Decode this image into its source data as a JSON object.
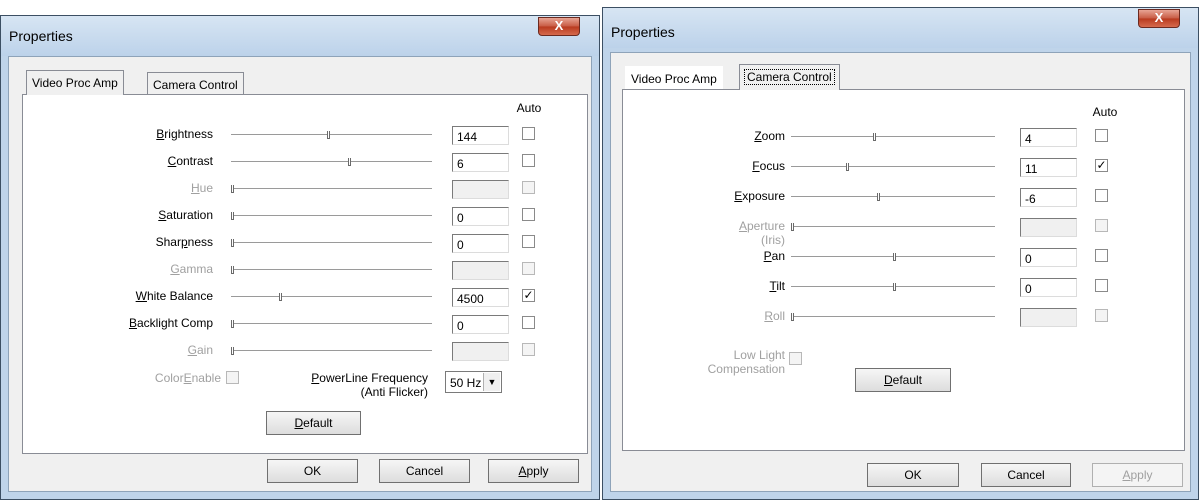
{
  "left": {
    "title": "Properties",
    "close_label": "X",
    "tabs": [
      {
        "label": "Video Proc Amp",
        "active": true
      },
      {
        "label": "Camera Control",
        "active": false
      }
    ],
    "auto_header": "Auto",
    "rows": [
      {
        "label": "Brightness",
        "value": "144",
        "slider": 0.48,
        "enabled": true,
        "auto": false
      },
      {
        "label": "Contrast",
        "value": "6",
        "slider": 0.58,
        "enabled": true,
        "auto": false
      },
      {
        "label": "Hue",
        "value": "",
        "slider": 0.0,
        "enabled": false,
        "auto": false
      },
      {
        "label": "Saturation",
        "value": "0",
        "slider": 0.0,
        "enabled": true,
        "auto": false
      },
      {
        "label": "Sharpness",
        "value": "0",
        "slider": 0.0,
        "enabled": true,
        "auto": false
      },
      {
        "label": "Gamma",
        "value": "",
        "slider": 0.0,
        "enabled": false,
        "auto": false
      },
      {
        "label": "White Balance",
        "value": "4500",
        "slider": 0.24,
        "enabled": true,
        "auto": true
      },
      {
        "label": "Backlight Comp",
        "value": "0",
        "slider": 0.0,
        "enabled": true,
        "auto": false
      },
      {
        "label": "Gain",
        "value": "",
        "slider": 0.0,
        "enabled": false,
        "auto": false
      }
    ],
    "color_enable_label": "ColorEnable",
    "powerline_label": "PowerLine Frequency",
    "powerline_sub": "(Anti Flicker)",
    "powerline_value": "50 Hz",
    "default_label": "Default",
    "ok_label": "OK",
    "cancel_label": "Cancel",
    "apply_label": "Apply"
  },
  "right": {
    "title": "Properties",
    "close_label": "X",
    "tabs": [
      {
        "label": "Video Proc Amp",
        "active": false
      },
      {
        "label": "Camera Control",
        "active": true
      }
    ],
    "auto_header": "Auto",
    "rows": [
      {
        "label": "Zoom",
        "sub": "",
        "value": "4",
        "slider": 0.4,
        "enabled": true,
        "auto": false
      },
      {
        "label": "Focus",
        "sub": "",
        "value": "11",
        "slider": 0.27,
        "enabled": true,
        "auto": true
      },
      {
        "label": "Exposure",
        "sub": "",
        "value": "-6",
        "slider": 0.42,
        "enabled": true,
        "auto": false
      },
      {
        "label": "Aperture",
        "sub": "(Iris)",
        "value": "",
        "slider": 0.0,
        "enabled": false,
        "auto": false
      },
      {
        "label": "Pan",
        "sub": "",
        "value": "0",
        "slider": 0.5,
        "enabled": true,
        "auto": false
      },
      {
        "label": "Tilt",
        "sub": "",
        "value": "0",
        "slider": 0.5,
        "enabled": true,
        "auto": false
      },
      {
        "label": "Roll",
        "sub": "",
        "value": "",
        "slider": 0.0,
        "enabled": false,
        "auto": false
      }
    ],
    "lowlight_label": "Low Light",
    "lowlight_sub": "Compensation",
    "default_label": "Default",
    "ok_label": "OK",
    "cancel_label": "Cancel",
    "apply_label": "Apply"
  }
}
